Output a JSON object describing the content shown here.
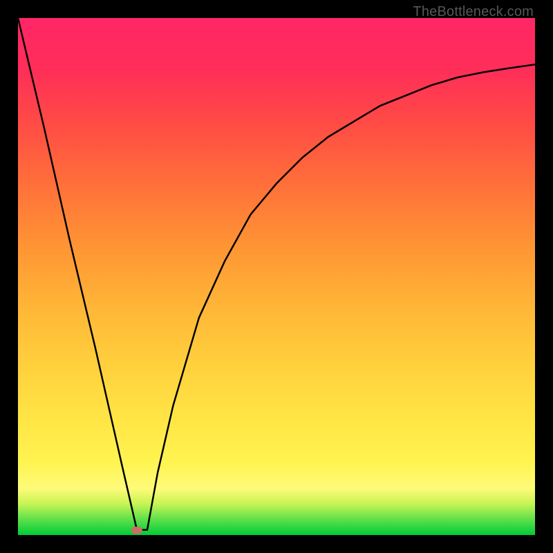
{
  "watermark": "TheBottleneck.com",
  "chart_data": {
    "type": "line",
    "title": "",
    "xlabel": "",
    "ylabel": "",
    "xlim": [
      0,
      100
    ],
    "ylim": [
      0,
      100
    ],
    "series": [
      {
        "name": "bottleneck-curve",
        "x": [
          0,
          5,
          10,
          15,
          20,
          23,
          25,
          27,
          30,
          35,
          40,
          45,
          50,
          55,
          60,
          65,
          70,
          75,
          80,
          85,
          90,
          95,
          100
        ],
        "values": [
          100,
          79,
          57,
          36,
          14,
          1,
          1,
          12,
          25,
          42,
          53,
          62,
          68,
          73,
          77,
          80,
          83,
          85,
          87,
          88.5,
          89.5,
          90.3,
          91
        ]
      }
    ],
    "marker": {
      "x": 23,
      "y": 1
    },
    "colors": {
      "curve": "#000000",
      "marker": "#d06b6b",
      "gradient_top": "#ff2666",
      "gradient_mid": "#ffd23d",
      "gradient_bottom": "#00cc36"
    }
  }
}
